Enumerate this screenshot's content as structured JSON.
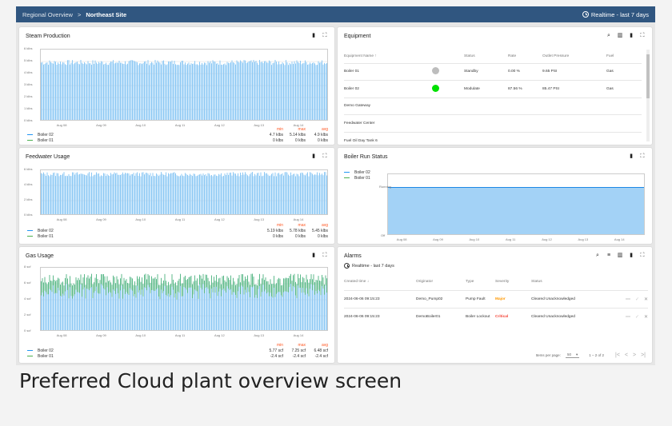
{
  "topbar": {
    "breadcrumb_1": "Regional Overview",
    "separator": ">",
    "breadcrumb_2": "Northeast Site",
    "timewindow": "Realtime - last 7 days",
    "color": "#305680"
  },
  "caption": "Preferred Cloud plant overview screen",
  "x_dates": [
    "Aug 08",
    "Aug 09",
    "Aug 10",
    "Aug 11",
    "Aug 12",
    "Aug 13",
    "Aug 14"
  ],
  "stats_headers": {
    "min": "min",
    "max": "max",
    "avg": "avg"
  },
  "steam": {
    "title": "Steam Production",
    "y_ticks": [
      "6 klbs",
      "5 klbs",
      "4 klbs",
      "3 klbs",
      "2 klbs",
      "1 klbs",
      "0 klbs"
    ],
    "series": [
      {
        "name": "Boiler 02",
        "color": "#2196f3",
        "min": "4.7 klbs",
        "max": "5.14 klbs",
        "avg": "4.9 klbs"
      },
      {
        "name": "Boiler 01",
        "color": "#4caf50",
        "min": "0 klbs",
        "max": "0 klbs",
        "avg": "0 klbs"
      }
    ]
  },
  "feedwater": {
    "title": "Feedwater Usage",
    "y_ticks": [
      "6 klbs",
      "4 klbs",
      "2 klbs",
      "0 klbs"
    ],
    "series": [
      {
        "name": "Boiler 02",
        "color": "#2196f3",
        "min": "5.19 klbs",
        "max": "5.78 klbs",
        "avg": "5.45 klbs"
      },
      {
        "name": "Boiler 01",
        "color": "#4caf50",
        "min": "0 klbs",
        "max": "0 klbs",
        "avg": "0 klbs"
      }
    ]
  },
  "gas": {
    "title": "Gas Usage",
    "y_ticks": [
      "8 scf",
      "6 scf",
      "4 scf",
      "2 scf",
      "0 scf"
    ],
    "series": [
      {
        "name": "Boiler 02",
        "color": "#2196f3",
        "min": "5.77 scf",
        "max": "7.25 scf",
        "avg": "6.48 scf"
      },
      {
        "name": "Boiler 01",
        "color": "#4caf50",
        "min": "-2.4 scf",
        "max": "-2.4 scf",
        "avg": "-2.4 scf"
      }
    ]
  },
  "equipment": {
    "title": "Equipment",
    "headers": {
      "name": "Equipment Name",
      "status": "Status",
      "rate": "Rate",
      "pressure": "Outlet Pressure",
      "fuel": "Fuel"
    },
    "sort_arrow": "↑",
    "rows": [
      {
        "name": "Boiler 01",
        "dot": "#bdbdbd",
        "status": "Standby",
        "rate": "0.00 %",
        "pressure": "9.65 PSI",
        "fuel": "Gas"
      },
      {
        "name": "Boiler 02",
        "dot": "#00e000",
        "status": "Modulate",
        "rate": "87.56 %",
        "pressure": "85.47 PSI",
        "fuel": "Gas"
      },
      {
        "name": "Demo Gateway",
        "dot": "",
        "status": "",
        "rate": "",
        "pressure": "",
        "fuel": ""
      },
      {
        "name": "Feedwater Center",
        "dot": "",
        "status": "",
        "rate": "",
        "pressure": "",
        "fuel": ""
      },
      {
        "name": "Fuel Oil Day Tank 6",
        "dot": "",
        "status": "",
        "rate": "",
        "pressure": "",
        "fuel": ""
      }
    ]
  },
  "runstatus": {
    "title": "Boiler Run Status",
    "y_top": "Running",
    "y_bottom": "Off",
    "legend": [
      {
        "name": "Boiler 02",
        "color": "#2196f3"
      },
      {
        "name": "Boiler 01",
        "color": "#4caf50"
      }
    ],
    "x_dates": [
      "Aug 08",
      "Aug 09",
      "Aug 10",
      "Aug 11",
      "Aug 12",
      "Aug 13",
      "Aug 14"
    ]
  },
  "alarms": {
    "title": "Alarms",
    "timewindow": "Realtime - last 7 days",
    "headers": {
      "created": "Created time",
      "originator": "Originator",
      "type": "Type",
      "severity": "Severity",
      "status": "Status"
    },
    "sort_arrow": "↓",
    "rows": [
      {
        "created": "2024-06-06 09:15:23",
        "originator": "Demo_Pump02",
        "type": "Pump Fault",
        "severity": "Major",
        "sev_color": "#ff9800",
        "status": "Cleared Unacknowledged"
      },
      {
        "created": "2024-06-06 09:15:23",
        "originator": "DemoBoiler01",
        "type": "Boiler Lockout",
        "severity": "Critical",
        "sev_color": "#f44336",
        "status": "Cleared Unacknowledged"
      }
    ],
    "items_per_page_label": "Items per page:",
    "items_per_page": "50",
    "range": "1 – 2 of 2"
  }
}
